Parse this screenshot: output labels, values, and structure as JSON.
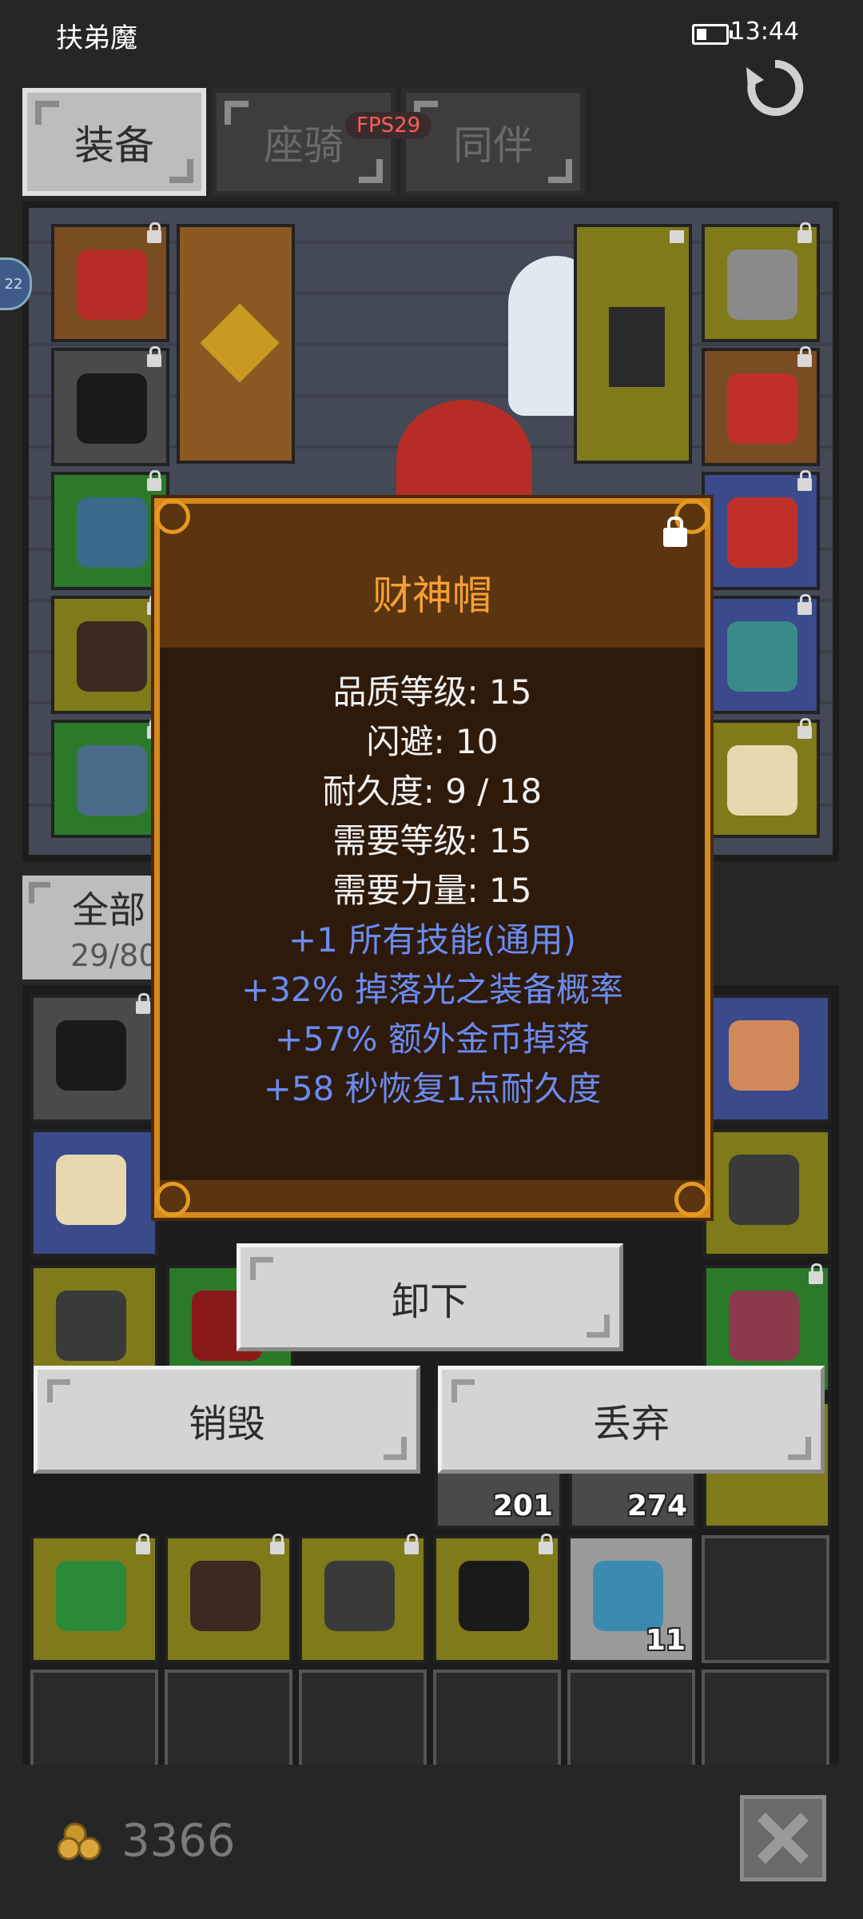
{
  "status_bar": {
    "app_name": "扶弟魔",
    "time": "13:44"
  },
  "tabs": [
    {
      "label": "装备",
      "active": true
    },
    {
      "label": "座骑",
      "active": false
    },
    {
      "label": "同伴",
      "active": false
    }
  ],
  "fps": "FPS29",
  "side_badge": "22",
  "inventory": {
    "tab_label": "全部",
    "capacity": "29/80"
  },
  "inventory_counts": [
    "201",
    "274",
    "11"
  ],
  "popup": {
    "title": "财神帽",
    "stats": [
      {
        "text": "品质等级: 15",
        "type": "base"
      },
      {
        "text": "闪避: 10",
        "type": "base"
      },
      {
        "text": "耐久度: 9 / 18",
        "type": "base"
      },
      {
        "text": "需要等级: 15",
        "type": "base"
      },
      {
        "text": "需要力量: 15",
        "type": "base"
      },
      {
        "text": "+1 所有技能(通用)",
        "type": "magic"
      },
      {
        "text": "+32% 掉落光之装备概率",
        "type": "magic"
      },
      {
        "text": "+57% 额外金币掉落",
        "type": "magic"
      },
      {
        "text": "+58 秒恢复1点耐久度",
        "type": "magic"
      }
    ]
  },
  "buttons": {
    "unequip": "卸下",
    "destroy": "销毁",
    "discard": "丢弃"
  },
  "gold": "3366",
  "colors": {
    "popup_border": "#d68a1c",
    "popup_title": "#f5a033",
    "magic_stat": "#6a8cf0",
    "fps_text": "#ff5c5c"
  },
  "icons": [
    "battery-icon",
    "refresh-icon",
    "lock-icon",
    "gold-coins-icon",
    "close-icon"
  ]
}
